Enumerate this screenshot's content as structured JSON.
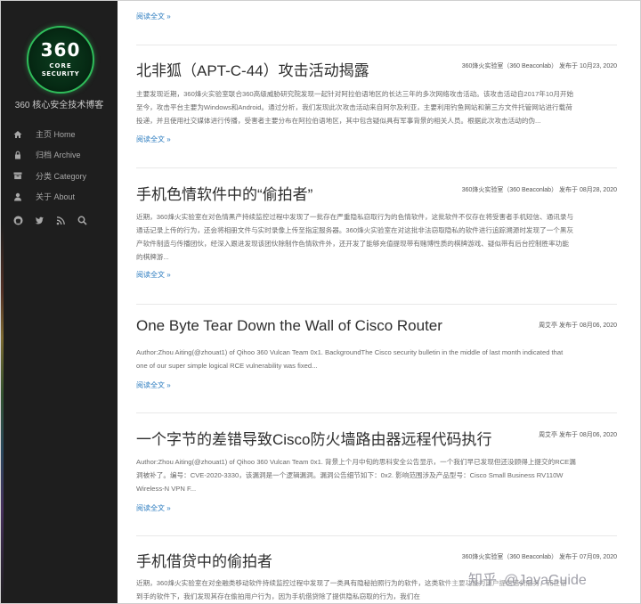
{
  "sidebar": {
    "logo": {
      "number": "360",
      "line1": "CORE",
      "line2": "SECURITY"
    },
    "site_title": "360 核心安全技术博客",
    "nav": [
      {
        "icon": "home-icon",
        "label": "主页 Home"
      },
      {
        "icon": "lock-icon",
        "label": "归档 Archive"
      },
      {
        "icon": "archive-box-icon",
        "label": "分类 Category"
      },
      {
        "icon": "user-icon",
        "label": "关于 About"
      }
    ],
    "social": [
      "github-icon",
      "twitter-icon",
      "rss-icon",
      "search-icon"
    ]
  },
  "top_read_more": "阅读全文 »",
  "posts": [
    {
      "title": "北非狐（APT-C-44）攻击活动揭露",
      "meta": "360烽火实验室（360 Beaconlab） 发布于 10月23, 2020",
      "excerpt": [
        "主要发现近期，360烽火实验室联合360高级威胁研究院发现一起针对阿拉伯语地区的长达三年的多次网络攻击活动。该攻击活动自2017年10月开始",
        "至今，攻击平台主要为Windows和Android。通过分析，我们发现此次攻击活动来自阿尔及利亚，主要利用钓鱼网站和第三方文件托管网站进行载荷",
        "投递，并且使用社交媒体进行传播，受害者主要分布在阿拉伯语地区，其中包含疑似具有军事背景的相关人员。根据此次攻击活动的伪..."
      ],
      "read_more": "阅读全文 »"
    },
    {
      "title": "手机色情软件中的“偷拍者”",
      "meta": "360烽火实验室（360 Beaconlab） 发布于 08月28, 2020",
      "excerpt": [
        "近期，360烽火实验室在对色情黑产持续监控过程中发现了一批存在严重隐私窃取行为的色情软件，这批软件不仅存在将受害者手机短信、通讯录与",
        "通话记录上传的行为，还会将相册文件与实时录像上传至指定服务器。360烽火实验室在对这批非法窃取隐私的软件进行追踪溯源时发现了一个黑灰",
        "产软件制造与传播团伙，经深入跟进发现该团伙除制作色情软件外，还开发了能够充值提现带有赌博性质的棋牌游戏、疑似带有后台控制胜率功能",
        "的棋牌游..."
      ],
      "read_more": "阅读全文 »"
    },
    {
      "title": "One Byte Tear Down the Wall of Cisco Router",
      "meta": "周艾亭 发布于 08月06, 2020",
      "excerpt": [
        "Author:Zhou Aiting(@zhouat1) of Qihoo 360 Vulcan Team 0x1. BackgroundThe Cisco security bulletin in the middle of last month indicated that",
        "one of our super simple logical RCE vulnerability was fixed..."
      ],
      "read_more": "阅读全文 »"
    },
    {
      "title": "一个字节的差错导致Cisco防火墙路由器远程代码执行",
      "meta": "周艾亭 发布于 08月06, 2020",
      "excerpt": [
        "Author:Zhou Aiting(@zhouat1) of Qihoo 360 Vulcan Team 0x1. 背景上个月中旬的思科安全公告显示，一个我们早已发现但还没顾得上提交的RCE漏",
        "洞被补了。编号：CVE-2020-3330，该漏洞是一个逻辑漏洞。漏洞公告细节如下：0x2. 影响范围涉及产品型号：Cisco Small Business RV110W",
        "Wireless-N VPN F..."
      ],
      "read_more": "阅读全文 »"
    },
    {
      "title": "手机借贷中的偷拍者",
      "meta": "360烽火实验室（360 Beaconlab） 发布于 07月09, 2020",
      "excerpt": [
        "近期，360烽火实验室在对金融类移动软件持续监控过程中发现了一类具有隐秘拍照行为的软件，这类软件主要功能为用户提供借贷服务，而在借",
        "到手的软件下，我们发现其存在偷拍用户行为，因为手机借贷除了提供隐私窃取的行为，我们在"
      ],
      "read_more": ""
    }
  ],
  "watermark": {
    "zh": "知乎",
    "handle": "@JavaGuide"
  }
}
